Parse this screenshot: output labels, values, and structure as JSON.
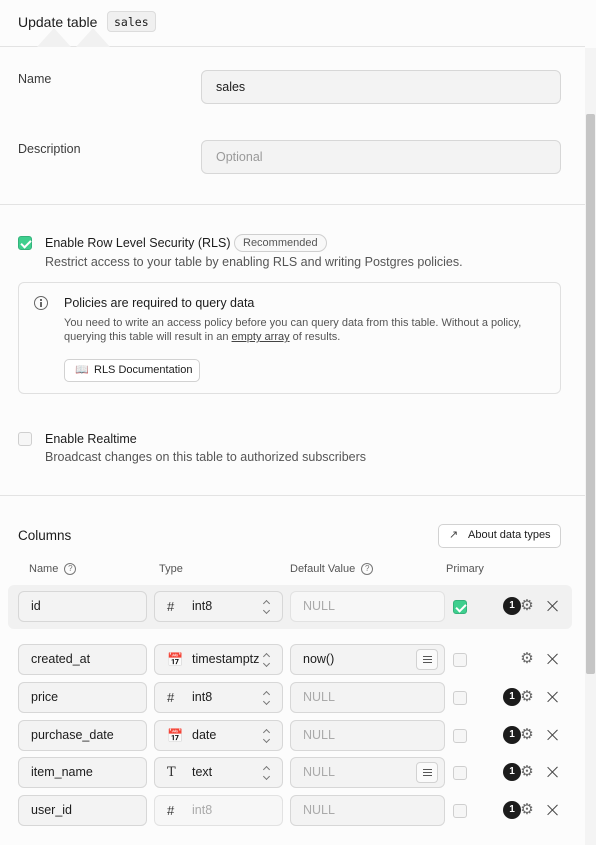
{
  "header": {
    "title": "Update table",
    "table_code": "sales"
  },
  "form": {
    "name_label": "Name",
    "name_value": "sales",
    "description_label": "Description",
    "description_placeholder": "Optional"
  },
  "rls": {
    "enabled": true,
    "label": "Enable Row Level Security (RLS)",
    "badge": "Recommended",
    "description": "Restrict access to your table by enabling RLS and writing Postgres policies.",
    "alert": {
      "title": "Policies are required to query data",
      "text_line1": "You need to write an access policy before you can query data from this table. Without a policy,",
      "text_line2_before": "querying this table will result in an ",
      "text_line2_link": "empty array",
      "text_line2_after": " of results.",
      "doc_button": "RLS Documentation"
    }
  },
  "realtime": {
    "enabled": false,
    "label": "Enable Realtime",
    "description": "Broadcast changes on this table to authorized subscribers"
  },
  "columns": {
    "title": "Columns",
    "about_button": "About data types",
    "headers": {
      "name": "Name",
      "type": "Type",
      "default": "Default Value",
      "primary": "Primary"
    },
    "rows": [
      {
        "name": "id",
        "type": "int8",
        "type_icon": "hash-icon",
        "default": "NULL",
        "primary": true,
        "count": "1"
      },
      {
        "name": "created_at",
        "type": "timestamptz",
        "type_icon": "calendar-icon",
        "default": "now()",
        "primary": false,
        "count": ""
      },
      {
        "name": "price",
        "type": "int8",
        "type_icon": "hash-icon",
        "default": "NULL",
        "primary": false,
        "count": "1"
      },
      {
        "name": "purchase_date",
        "type": "date",
        "type_icon": "calendar-icon",
        "default": "NULL",
        "primary": false,
        "count": "1"
      },
      {
        "name": "item_name",
        "type": "text",
        "type_icon": "text-type-icon",
        "default": "NULL",
        "primary": false,
        "count": "1"
      },
      {
        "name": "user_id",
        "type": "int8",
        "type_icon": "hash-icon",
        "default": "NULL",
        "primary": false,
        "count": "1"
      }
    ]
  }
}
